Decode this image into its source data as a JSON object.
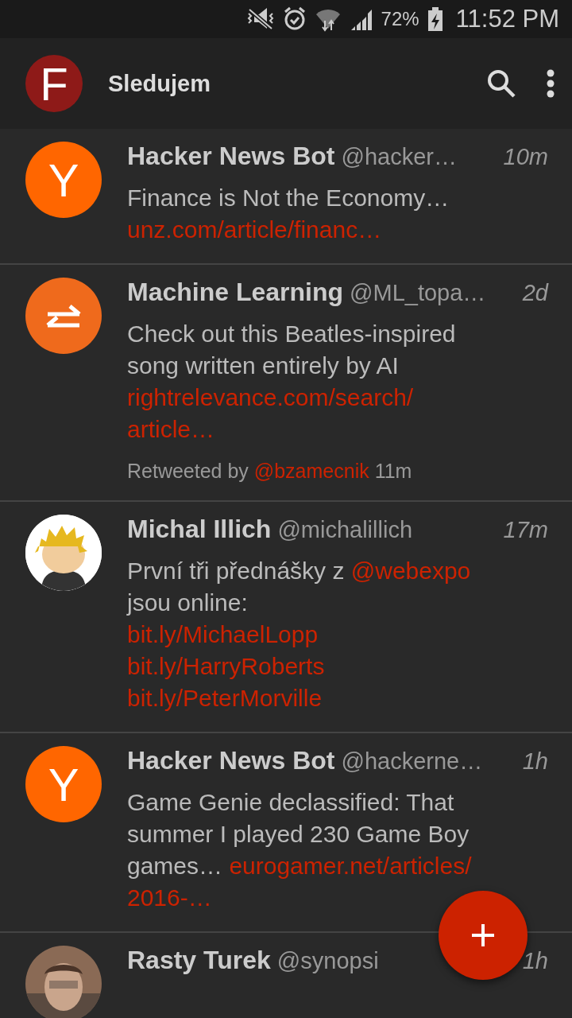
{
  "status_bar": {
    "battery": "72%",
    "time": "11:52 PM"
  },
  "app_bar": {
    "logo_letter": "F",
    "title": "Sledujem"
  },
  "tweets": [
    {
      "avatar": {
        "kind": "letter",
        "letter": "Y"
      },
      "name": "Hacker News Bot",
      "handle": "@hacker…",
      "time": "10m",
      "lines": [
        [
          {
            "kind": "text",
            "text": "Finance is Not the Economy…"
          }
        ],
        [
          {
            "kind": "link",
            "text": "unz.com/article/financ…"
          }
        ]
      ]
    },
    {
      "avatar": {
        "kind": "arrows"
      },
      "name": "Machine Learning",
      "handle": "@ML_topa…",
      "time": "2d",
      "lines": [
        [
          {
            "kind": "text",
            "text": "Check out this Beatles-inspired"
          }
        ],
        [
          {
            "kind": "text",
            "text": "song written entirely by AI"
          }
        ],
        [
          {
            "kind": "link",
            "text": "rightrelevance.com/search/"
          }
        ],
        [
          {
            "kind": "link",
            "text": "article…"
          }
        ]
      ],
      "retweet": [
        {
          "kind": "text",
          "text": "Retweeted by "
        },
        {
          "kind": "link",
          "text": "@bzamecnik"
        },
        {
          "kind": "text",
          "text": " 11m"
        }
      ]
    },
    {
      "avatar": {
        "kind": "cartoon"
      },
      "name": "Michal Illich",
      "handle": "@michalillich",
      "time": "17m",
      "lines": [
        [
          {
            "kind": "text",
            "text": "První tři přednášky z "
          },
          {
            "kind": "link",
            "text": "@webexpo"
          }
        ],
        [
          {
            "kind": "text",
            "text": "jsou online:"
          }
        ],
        [
          {
            "kind": "link",
            "text": "bit.ly/MichaelLopp"
          }
        ],
        [
          {
            "kind": "link",
            "text": "bit.ly/HarryRoberts"
          }
        ],
        [
          {
            "kind": "link",
            "text": "bit.ly/PeterMorville"
          }
        ]
      ]
    },
    {
      "avatar": {
        "kind": "letter",
        "letter": "Y"
      },
      "name": "Hacker News Bot",
      "handle": "@hackerne…",
      "time": "1h",
      "lines": [
        [
          {
            "kind": "text",
            "text": "Game Genie declassified: That"
          }
        ],
        [
          {
            "kind": "text",
            "text": "summer I played 230 Game Boy"
          }
        ],
        [
          {
            "kind": "text",
            "text": "games… "
          },
          {
            "kind": "link",
            "text": "eurogamer.net/articles/"
          }
        ],
        [
          {
            "kind": "link",
            "text": "2016-…"
          }
        ]
      ]
    },
    {
      "name": "Rasty Turek",
      "handle": "@synopsi",
      "time": "1h"
    }
  ]
}
